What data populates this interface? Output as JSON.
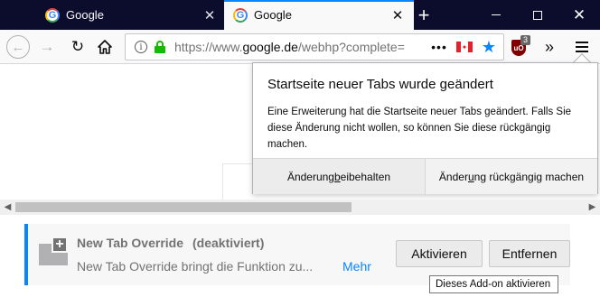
{
  "tabs": [
    {
      "title": "Google",
      "favicon": "google-icon",
      "active": false
    },
    {
      "title": "Google",
      "favicon": "google-icon",
      "active": true
    }
  ],
  "window_controls": {
    "minimize": "minimize-icon",
    "maximize": "maximize-icon",
    "close": "close-icon"
  },
  "navbar": {
    "url_domain_prefix": "https://www.",
    "url_domain": "google.de",
    "url_path": "/webhp?complete=",
    "page_actions": "•••",
    "ublock_badge": "3",
    "ublock_label": "uO"
  },
  "panel": {
    "title": "Startseite neuer Tabs wurde geändert",
    "body": "Eine Erweiterung hat die Startseite neuer Tabs geändert. Falls Sie diese Änderung nicht wollen, so können Sie diese rückgängig machen.",
    "keep_prefix": "Änderung ",
    "keep_access": "b",
    "keep_suffix": "eibehalten",
    "undo_prefix": "Änder",
    "undo_access": "u",
    "undo_suffix": "ng rückgängig machen"
  },
  "addon": {
    "name": "New Tab Override",
    "state": "(deaktiviert)",
    "description": "New Tab Override bringt die Funktion zu...",
    "more_link": "Mehr",
    "enable_label": "Aktivieren",
    "remove_label": "Entfernen",
    "tooltip": "Dieses Add-on aktivieren"
  },
  "colors": {
    "accent": "#0a84ff",
    "titlebar": "#0c0c2c",
    "secure": "#12bc00"
  }
}
